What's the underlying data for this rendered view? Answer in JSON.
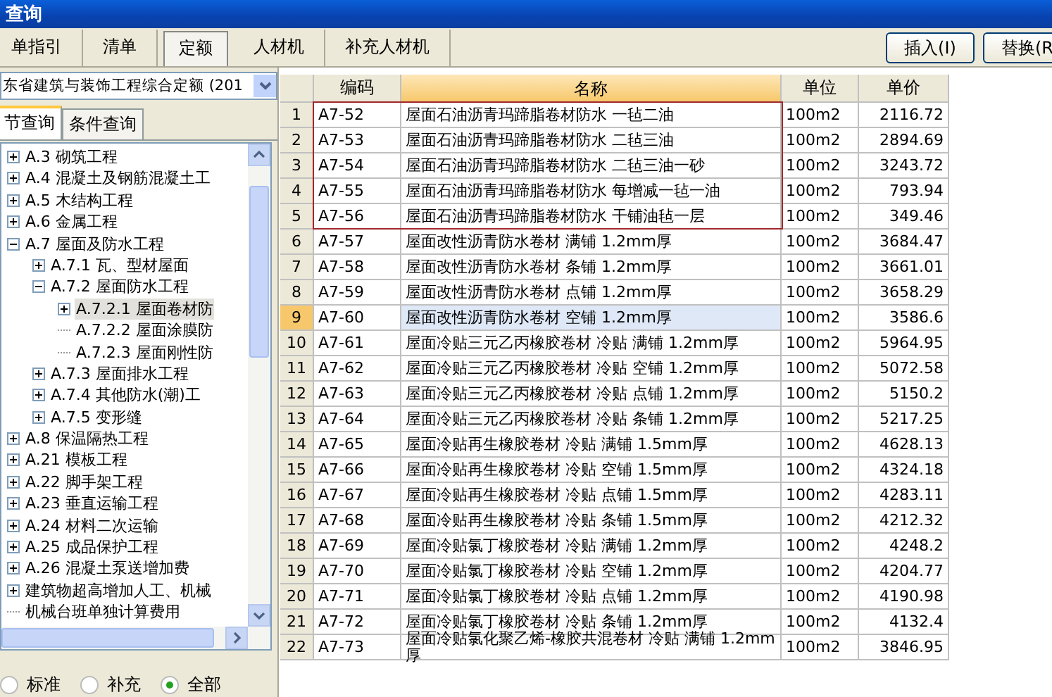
{
  "window": {
    "title": "查询"
  },
  "tabs": [
    {
      "label": "单指引",
      "selected": false
    },
    {
      "label": "清单",
      "selected": false
    },
    {
      "label": "定额",
      "selected": true
    },
    {
      "label": "人材机",
      "selected": false
    },
    {
      "label": "补充人材机",
      "selected": false
    }
  ],
  "buttons": [
    "插入(I)",
    "替换(R"
  ],
  "library_select": {
    "value": "东省建筑与装饰工程综合定额 (201"
  },
  "query_tabs": [
    {
      "label": "节查询",
      "selected": true
    },
    {
      "label": "条件查询",
      "selected": false
    }
  ],
  "tree": [
    {
      "label": "A.3 砌筑工程",
      "expanded": false,
      "selected": false
    },
    {
      "label": "A.4 混凝土及钢筋混凝土工",
      "expanded": false,
      "selected": false
    },
    {
      "label": "A.5 木结构工程",
      "expanded": false,
      "selected": false
    },
    {
      "label": "A.6 金属工程",
      "expanded": false,
      "selected": false
    },
    {
      "label": "A.7 屋面及防水工程",
      "expanded": true,
      "selected": false,
      "children": [
        {
          "label": "A.7.1 瓦、型材屋面",
          "expanded": false,
          "selected": false
        },
        {
          "label": "A.7.2 屋面防水工程",
          "expanded": true,
          "selected": false,
          "children": [
            {
              "label": "A.7.2.1 屋面卷材防",
              "expanded": false,
              "selected": true
            },
            {
              "label": "A.7.2.2 屋面涂膜防",
              "selected": false
            },
            {
              "label": "A.7.2.3 屋面刚性防",
              "selected": false
            }
          ]
        },
        {
          "label": "A.7.3 屋面排水工程",
          "expanded": false,
          "selected": false
        },
        {
          "label": "A.7.4 其他防水(潮)工",
          "expanded": false,
          "selected": false
        },
        {
          "label": "A.7.5 变形缝",
          "expanded": false,
          "selected": false
        }
      ]
    },
    {
      "label": "A.8 保温隔热工程",
      "expanded": false,
      "selected": false
    },
    {
      "label": "A.21 模板工程",
      "expanded": false,
      "selected": false
    },
    {
      "label": "A.22 脚手架工程",
      "expanded": false,
      "selected": false
    },
    {
      "label": "A.23 垂直运输工程",
      "expanded": false,
      "selected": false
    },
    {
      "label": "A.24 材料二次运输",
      "expanded": false,
      "selected": false
    },
    {
      "label": "A.25 成品保护工程",
      "expanded": false,
      "selected": false
    },
    {
      "label": "A.26 混凝土泵送增加费",
      "expanded": false,
      "selected": false
    },
    {
      "label": "建筑物超高增加人工、机械",
      "expanded": false,
      "selected": false
    },
    {
      "label": "机械台班单独计算费用",
      "selected": false
    }
  ],
  "filter": [
    {
      "label": "标准",
      "selected": false
    },
    {
      "label": "补充",
      "selected": false
    },
    {
      "label": "全部",
      "selected": true
    }
  ],
  "table": {
    "columns": [
      "编码",
      "名称",
      "单位",
      "单价"
    ],
    "rows": [
      {
        "index": "1",
        "code": "A7-52",
        "name": "屋面石油沥青玛蹄脂卷材防水 一毡二油",
        "unit": "100m2",
        "price": "2116.72",
        "selected": false
      },
      {
        "index": "2",
        "code": "A7-53",
        "name": "屋面石油沥青玛蹄脂卷材防水 二毡三油",
        "unit": "100m2",
        "price": "2894.69",
        "selected": false
      },
      {
        "index": "3",
        "code": "A7-54",
        "name": "屋面石油沥青玛蹄脂卷材防水 二毡三油一砂",
        "unit": "100m2",
        "price": "3243.72",
        "selected": false
      },
      {
        "index": "4",
        "code": "A7-55",
        "name": "屋面石油沥青玛蹄脂卷材防水 每增减一毡一油",
        "unit": "100m2",
        "price": "793.94",
        "selected": false
      },
      {
        "index": "5",
        "code": "A7-56",
        "name": "屋面石油沥青玛蹄脂卷材防水 干铺油毡一层",
        "unit": "100m2",
        "price": "349.46",
        "selected": false
      },
      {
        "index": "6",
        "code": "A7-57",
        "name": "屋面改性沥青防水卷材 满铺 1.2mm厚",
        "unit": "100m2",
        "price": "3684.47",
        "selected": false
      },
      {
        "index": "7",
        "code": "A7-58",
        "name": "屋面改性沥青防水卷材 条铺 1.2mm厚",
        "unit": "100m2",
        "price": "3661.01",
        "selected": false
      },
      {
        "index": "8",
        "code": "A7-59",
        "name": "屋面改性沥青防水卷材 点铺 1.2mm厚",
        "unit": "100m2",
        "price": "3658.29",
        "selected": false
      },
      {
        "index": "9",
        "code": "A7-60",
        "name": "屋面改性沥青防水卷材 空铺 1.2mm厚",
        "unit": "100m2",
        "price": "3586.6",
        "selected": true
      },
      {
        "index": "10",
        "code": "A7-61",
        "name": "屋面冷贴三元乙丙橡胶卷材 冷贴 满铺 1.2mm厚",
        "unit": "100m2",
        "price": "5964.95",
        "selected": false
      },
      {
        "index": "11",
        "code": "A7-62",
        "name": "屋面冷贴三元乙丙橡胶卷材 冷贴 空铺 1.2mm厚",
        "unit": "100m2",
        "price": "5072.58",
        "selected": false
      },
      {
        "index": "12",
        "code": "A7-63",
        "name": "屋面冷贴三元乙丙橡胶卷材 冷贴 点铺 1.2mm厚",
        "unit": "100m2",
        "price": "5150.2",
        "selected": false
      },
      {
        "index": "13",
        "code": "A7-64",
        "name": "屋面冷贴三元乙丙橡胶卷材 冷贴 条铺 1.2mm厚",
        "unit": "100m2",
        "price": "5217.25",
        "selected": false
      },
      {
        "index": "14",
        "code": "A7-65",
        "name": "屋面冷贴再生橡胶卷材 冷贴 满铺 1.5mm厚",
        "unit": "100m2",
        "price": "4628.13",
        "selected": false
      },
      {
        "index": "15",
        "code": "A7-66",
        "name": "屋面冷贴再生橡胶卷材 冷贴 空铺 1.5mm厚",
        "unit": "100m2",
        "price": "4324.18",
        "selected": false
      },
      {
        "index": "16",
        "code": "A7-67",
        "name": "屋面冷贴再生橡胶卷材 冷贴 点铺 1.5mm厚",
        "unit": "100m2",
        "price": "4283.11",
        "selected": false
      },
      {
        "index": "17",
        "code": "A7-68",
        "name": "屋面冷贴再生橡胶卷材 冷贴 条铺 1.5mm厚",
        "unit": "100m2",
        "price": "4212.32",
        "selected": false
      },
      {
        "index": "18",
        "code": "A7-69",
        "name": "屋面冷贴氯丁橡胶卷材 冷贴 满铺 1.2mm厚",
        "unit": "100m2",
        "price": "4248.2",
        "selected": false
      },
      {
        "index": "19",
        "code": "A7-70",
        "name": "屋面冷贴氯丁橡胶卷材 冷贴 空铺 1.2mm厚",
        "unit": "100m2",
        "price": "4204.77",
        "selected": false
      },
      {
        "index": "20",
        "code": "A7-71",
        "name": "屋面冷贴氯丁橡胶卷材 冷贴 点铺 1.2mm厚",
        "unit": "100m2",
        "price": "4190.98",
        "selected": false
      },
      {
        "index": "21",
        "code": "A7-72",
        "name": "屋面冷贴氯丁橡胶卷材 冷贴 条铺 1.2mm厚",
        "unit": "100m2",
        "price": "4132.4",
        "selected": false
      },
      {
        "index": "22",
        "code": "A7-73",
        "name": "屋面冷贴氯化聚乙烯-橡胶共混卷材 冷贴 满铺 1.2mm厚",
        "unit": "100m2",
        "price": "3846.95",
        "selected": false
      }
    ]
  }
}
